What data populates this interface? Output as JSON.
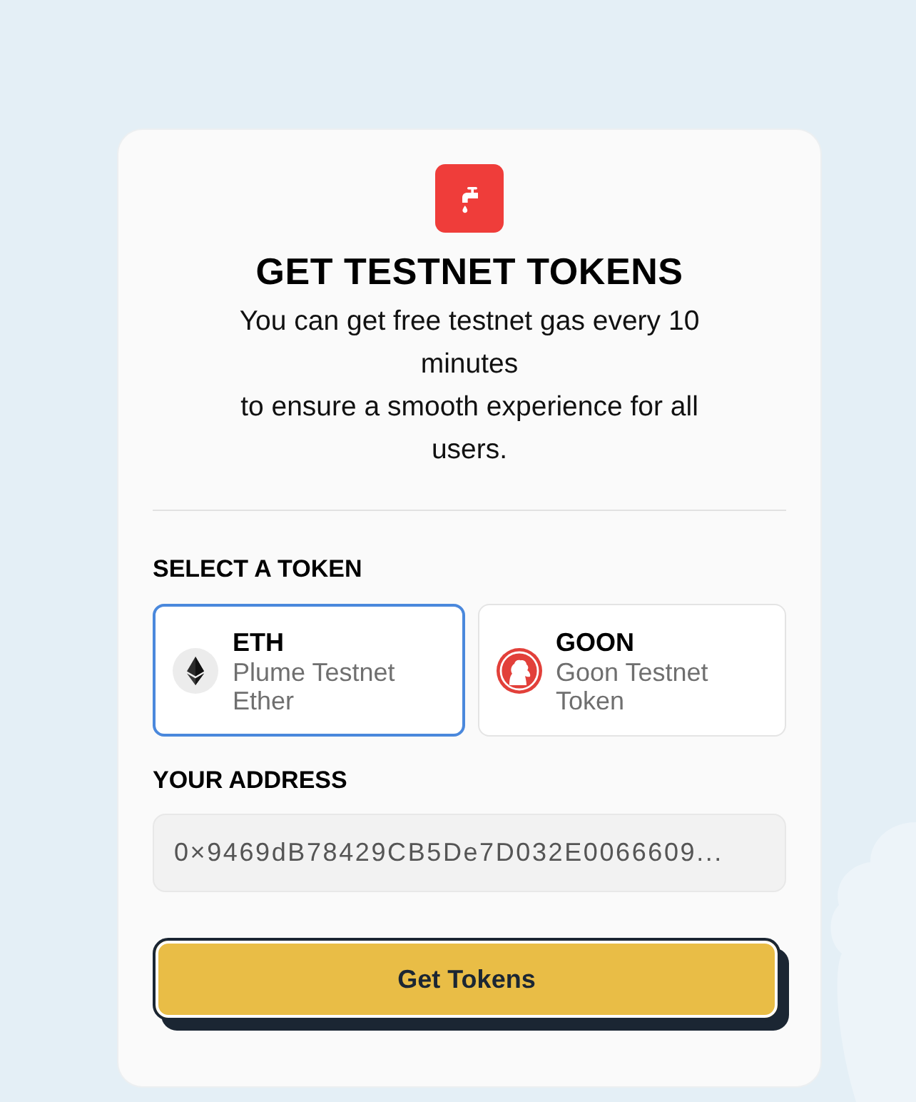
{
  "header": {
    "title": "GET TESTNET TOKENS",
    "subtitle_lines": [
      "You can get free testnet gas every 10 minutes",
      "to ensure a smooth experience for all users."
    ]
  },
  "token_section": {
    "label": "SELECT A TOKEN",
    "tokens": [
      {
        "kind": "eth",
        "symbol": "ETH",
        "name": "Plume Testnet Ether",
        "selected": true
      },
      {
        "kind": "goon",
        "symbol": "GOON",
        "name": "Goon Testnet Token",
        "selected": false
      }
    ]
  },
  "address": {
    "label": "YOUR ADDRESS",
    "value": "0×9469dB78429CB5De7D032E0066609..."
  },
  "submit_button": {
    "label": "Get Tokens"
  }
}
